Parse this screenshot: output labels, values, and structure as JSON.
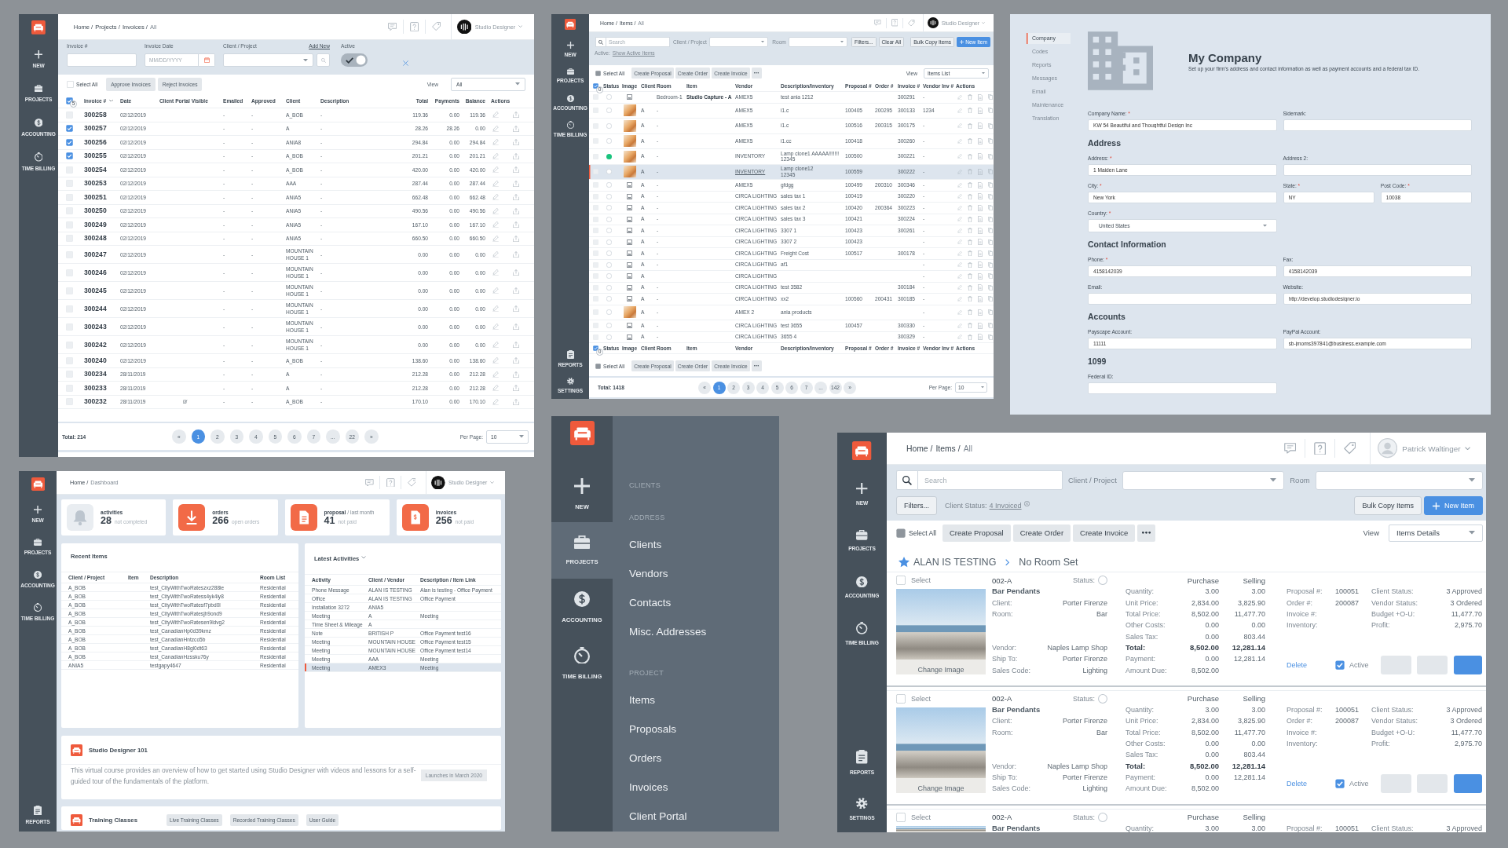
{
  "invoices_page": {
    "sidebar": {
      "items": [
        {
          "kind": "new",
          "label": "NEW"
        },
        {
          "kind": "projects",
          "label": "PROJECTS"
        },
        {
          "kind": "accounting",
          "label": "ACCOUNTING"
        },
        {
          "kind": "timebilling",
          "label": "TIME BILLING"
        }
      ]
    },
    "top_bar": {
      "breadcrumb": [
        "Home /",
        "Projects /",
        "Invoices /",
        "All"
      ],
      "user": {
        "kind": "logo",
        "name": "Studio Designer"
      }
    },
    "filters": {
      "invoice_label": "Invoice #",
      "date_label": "Invoice Date",
      "date_placeholder": "MM/DD/YYYY",
      "client_label": "Client / Project",
      "add_new": "Add New",
      "active_label": "Active",
      "active_on": true
    },
    "toolbar": {
      "select_all": "Select All",
      "select_all_checked": false,
      "buttons": [
        "Approve Invoices",
        "Reject Invoices"
      ],
      "view_label": "View",
      "view_value": "All"
    },
    "table": {
      "header_checked": true,
      "selected_count": "5",
      "columns": [
        "Invoice #",
        "Date",
        "Client Portal Visible",
        "Emailed",
        "Approved",
        "Client",
        "Description",
        "Total",
        "Payments",
        "Balance",
        "Actions"
      ],
      "rows": [
        {
          "checked": false,
          "invoice": "300258",
          "date": "02/12/2019",
          "portal_visible": false,
          "emailed": "-",
          "approved": "-",
          "client": "A_BOB",
          "description": "-",
          "total": "119.36",
          "payments": "0.00",
          "balance": "119.36"
        },
        {
          "checked": true,
          "invoice": "300257",
          "date": "02/12/2019",
          "portal_visible": false,
          "emailed": "-",
          "approved": "-",
          "client": "A",
          "description": "-",
          "total": "28.26",
          "payments": "28.26",
          "balance": "0.00"
        },
        {
          "checked": true,
          "invoice": "300256",
          "date": "02/12/2019",
          "portal_visible": false,
          "emailed": "-",
          "approved": "-",
          "client": "ANIA8",
          "description": "-",
          "total": "294.84",
          "payments": "0.00",
          "balance": "294.84"
        },
        {
          "checked": true,
          "invoice": "300255",
          "date": "02/12/2019",
          "portal_visible": false,
          "emailed": "-",
          "approved": "-",
          "client": "A_BOB",
          "description": "-",
          "total": "201.21",
          "payments": "0.00",
          "balance": "201.21"
        },
        {
          "checked": false,
          "invoice": "300254",
          "date": "02/12/2019",
          "portal_visible": false,
          "emailed": "-",
          "approved": "-",
          "client": "A_BOB",
          "description": "-",
          "total": "420.00",
          "payments": "0.00",
          "balance": "420.00"
        },
        {
          "checked": false,
          "invoice": "300253",
          "date": "02/12/2019",
          "portal_visible": false,
          "emailed": "-",
          "approved": "-",
          "client": "AAA",
          "description": "-",
          "total": "287.44",
          "payments": "0.00",
          "balance": "287.44"
        },
        {
          "checked": false,
          "invoice": "300251",
          "date": "02/12/2019",
          "portal_visible": false,
          "emailed": "-",
          "approved": "-",
          "client": "ANIA5",
          "description": "-",
          "total": "662.48",
          "payments": "0.00",
          "balance": "662.48"
        },
        {
          "checked": false,
          "invoice": "300250",
          "date": "02/12/2019",
          "portal_visible": false,
          "emailed": "-",
          "approved": "-",
          "client": "ANIA5",
          "description": "-",
          "total": "490.56",
          "payments": "0.00",
          "balance": "490.56"
        },
        {
          "checked": false,
          "invoice": "300249",
          "date": "02/12/2019",
          "portal_visible": false,
          "emailed": "-",
          "approved": "-",
          "client": "ANIA5",
          "description": "-",
          "total": "167.10",
          "payments": "0.00",
          "balance": "167.10"
        },
        {
          "checked": false,
          "invoice": "300248",
          "date": "02/12/2019",
          "portal_visible": false,
          "emailed": "-",
          "approved": "-",
          "client": "ANIA5",
          "description": "-",
          "total": "660.50",
          "payments": "0.00",
          "balance": "660.50"
        },
        {
          "checked": false,
          "invoice": "300247",
          "date": "02/12/2019",
          "portal_visible": false,
          "emailed": "-",
          "approved": "-",
          "client": "MOUNTAIN HOUSE 1",
          "description": "-",
          "total": "0.00",
          "payments": "0.00",
          "balance": "0.00"
        },
        {
          "checked": false,
          "invoice": "300246",
          "date": "02/12/2019",
          "portal_visible": false,
          "emailed": "-",
          "approved": "-",
          "client": "MOUNTAIN HOUSE 1",
          "description": "-",
          "total": "0.00",
          "payments": "0.00",
          "balance": "0.00"
        },
        {
          "checked": false,
          "invoice": "300245",
          "date": "02/12/2019",
          "portal_visible": false,
          "emailed": "-",
          "approved": "-",
          "client": "MOUNTAIN HOUSE 1",
          "description": "-",
          "total": "0.00",
          "payments": "0.00",
          "balance": "0.00"
        },
        {
          "checked": false,
          "invoice": "300244",
          "date": "02/12/2019",
          "portal_visible": false,
          "emailed": "-",
          "approved": "-",
          "client": "MOUNTAIN HOUSE 1",
          "description": "-",
          "total": "0.00",
          "payments": "0.00",
          "balance": "0.00"
        },
        {
          "checked": false,
          "invoice": "300243",
          "date": "02/12/2019",
          "portal_visible": false,
          "emailed": "-",
          "approved": "-",
          "client": "MOUNTAIN HOUSE 1",
          "description": "-",
          "total": "0.00",
          "payments": "0.00",
          "balance": "0.00"
        },
        {
          "checked": false,
          "invoice": "300242",
          "date": "02/12/2019",
          "portal_visible": false,
          "emailed": "-",
          "approved": "-",
          "client": "MOUNTAIN HOUSE 1",
          "description": "-",
          "total": "0.00",
          "payments": "0.00",
          "balance": "0.00"
        },
        {
          "checked": false,
          "invoice": "300240",
          "date": "02/12/2019",
          "portal_visible": false,
          "emailed": "-",
          "approved": "-",
          "client": "A_BOB",
          "description": "-",
          "total": "138.60",
          "payments": "0.00",
          "balance": "138.60"
        },
        {
          "checked": false,
          "invoice": "300234",
          "date": "28/11/2019",
          "portal_visible": false,
          "emailed": "-",
          "approved": "-",
          "client": "A",
          "description": "-",
          "total": "212.28",
          "payments": "0.00",
          "balance": "212.28"
        },
        {
          "checked": false,
          "invoice": "300233",
          "date": "28/11/2019",
          "portal_visible": false,
          "emailed": "-",
          "approved": "-",
          "client": "A",
          "description": "-",
          "total": "212.28",
          "payments": "0.00",
          "balance": "212.28"
        },
        {
          "checked": false,
          "invoice": "300232",
          "date": "28/11/2019",
          "portal_visible": true,
          "emailed": "-",
          "approved": "-",
          "client": "A_BOB",
          "description": "-",
          "total": "170.10",
          "payments": "0.00",
          "balance": "170.10"
        }
      ]
    },
    "footer": {
      "total": "Total: 214",
      "pages": [
        {
          "label": "«",
          "selected": false
        },
        {
          "label": "1",
          "selected": true
        },
        {
          "label": "2",
          "selected": false
        },
        {
          "label": "3",
          "selected": false
        },
        {
          "label": "4",
          "selected": false
        },
        {
          "label": "5",
          "selected": false
        },
        {
          "label": "6",
          "selected": false
        },
        {
          "label": "7",
          "selected": false
        },
        {
          "label": "...",
          "selected": false
        },
        {
          "label": "22",
          "selected": false
        },
        {
          "label": "»",
          "selected": false
        }
      ],
      "per_page_label": "Per Page:",
      "per_page": "10"
    }
  },
  "items_list_page": {
    "sidebar": {
      "items": [
        {
          "kind": "new",
          "label": "NEW"
        },
        {
          "kind": "projects",
          "label": "PROJECTS"
        },
        {
          "kind": "accounting",
          "label": "ACCOUNTING"
        },
        {
          "kind": "timebilling",
          "label": "TIME BILLING"
        }
      ],
      "bottom_items": [
        {
          "kind": "reports",
          "label": "REPORTS"
        },
        {
          "kind": "settings",
          "label": "SETTINGS"
        }
      ]
    },
    "top_bar": {
      "breadcrumb": [
        "Home /",
        "Items /",
        "All"
      ],
      "user": {
        "kind": "logo",
        "name": "Studio Designer"
      }
    },
    "filters": {
      "search_placeholder": "Search",
      "client_label": "Client / Project",
      "room_label": "Room",
      "buttons": [
        "Filters...",
        "Clear All"
      ],
      "bulk_copy": "Bulk Copy Items",
      "new_item": "New Item",
      "active_label": "Active:",
      "active_link": "Show Active Items"
    },
    "toolbar": {
      "select_all": "Select All",
      "select_all_checked": false,
      "buttons": [
        "Create Proposal",
        "Create Order",
        "Create Invoice"
      ],
      "view_label": "View",
      "view_value": "Items List"
    },
    "table": {
      "header_checked": true,
      "header_count": "0",
      "columns": [
        "Status",
        "Image",
        "Client",
        "Room",
        "Item",
        "Vendor",
        "Description/Inventory",
        "Proposal #",
        "Order #",
        "Invoice #",
        "Vendor Inv #",
        "Actions"
      ],
      "rows": [
        {
          "checked": false,
          "selected": false,
          "status_set": false,
          "kind": "placeholder",
          "room": "Bedroom-1",
          "item": "Studio Capture - A",
          "vendor": "AMEX5",
          "description": "test ania 1212",
          "invoice": "300291",
          "vendor_inv": "-"
        },
        {
          "checked": false,
          "selected": false,
          "status_set": false,
          "kind": "photo",
          "client": "A",
          "room": "-",
          "vendor": "AMEX5",
          "description": "i1.c",
          "proposal": "100405",
          "order": "200295",
          "invoice": "300133",
          "vendor_inv": "1234"
        },
        {
          "checked": false,
          "selected": false,
          "status_set": false,
          "kind": "photo",
          "client": "A",
          "room": "-",
          "vendor": "AMEX5",
          "description": "i1.c",
          "proposal": "100516",
          "order": "200315",
          "invoice": "300175",
          "vendor_inv": "-"
        },
        {
          "checked": false,
          "selected": false,
          "status_set": false,
          "kind": "photo",
          "client": "A",
          "room": "-",
          "vendor": "AMEX5",
          "description": "i1.cc",
          "proposal": "100418",
          "invoice": "300260",
          "vendor_inv": "-"
        },
        {
          "checked": false,
          "selected": false,
          "status_set": true,
          "kind": "photo",
          "client": "A",
          "room": "-",
          "vendor": "INVENTORY",
          "description": "Lamp clone1 AAAAA!!!!!!!\n12345",
          "proposal": "100500",
          "invoice": "300221",
          "vendor_inv": "-"
        },
        {
          "checked": false,
          "selected": true,
          "status_set": false,
          "kind": "photo",
          "client": "A",
          "room": "-",
          "vendor": "INVENTORY",
          "description": "Lamp clone12\n12345",
          "proposal": "100559",
          "invoice": "300222",
          "vendor_inv": "-"
        },
        {
          "checked": false,
          "selected": false,
          "status_set": false,
          "kind": "placeholder",
          "client": "A",
          "room": "-",
          "vendor": "AMEX5",
          "description": "gfdgg",
          "proposal": "100499",
          "order": "200310",
          "invoice": "300346",
          "vendor_inv": "-"
        },
        {
          "checked": false,
          "selected": false,
          "status_set": false,
          "kind": "placeholder",
          "client": "A",
          "room": "-",
          "vendor": "CIRCA LIGHTING",
          "description": "sales tax 1",
          "proposal": "100419",
          "invoice": "300220",
          "vendor_inv": "-"
        },
        {
          "checked": false,
          "selected": false,
          "status_set": false,
          "kind": "placeholder",
          "client": "A",
          "room": "-",
          "vendor": "CIRCA LIGHTING",
          "description": "sales tax 2",
          "proposal": "100420",
          "order": "200364",
          "invoice": "300223",
          "vendor_inv": "-"
        },
        {
          "checked": false,
          "selected": false,
          "status_set": false,
          "kind": "placeholder",
          "client": "A",
          "room": "-",
          "vendor": "CIRCA LIGHTING",
          "description": "sales tax 3",
          "proposal": "100421",
          "invoice": "300224",
          "vendor_inv": "-"
        },
        {
          "checked": false,
          "selected": false,
          "status_set": false,
          "kind": "placeholder",
          "client": "A",
          "room": "-",
          "vendor": "CIRCA LIGHTING",
          "description": "3307 1",
          "proposal": "100423",
          "invoice": "300261",
          "vendor_inv": "-"
        },
        {
          "checked": false,
          "selected": false,
          "status_set": false,
          "kind": "placeholder",
          "client": "A",
          "room": "-",
          "vendor": "CIRCA LIGHTING",
          "description": "3307 2",
          "proposal": "100423",
          "vendor_inv": "-"
        },
        {
          "checked": false,
          "selected": false,
          "status_set": false,
          "kind": "placeholder",
          "client": "A",
          "room": "-",
          "vendor": "CIRCA LIGHTING",
          "description": "Freight Cost",
          "proposal": "100517",
          "invoice": "300178",
          "vendor_inv": "-"
        },
        {
          "checked": false,
          "selected": false,
          "status_set": false,
          "kind": "placeholder",
          "client": "A",
          "room": "-",
          "vendor": "CIRCA LIGHTING",
          "description": "af1",
          "vendor_inv": "-"
        },
        {
          "checked": false,
          "selected": false,
          "status_set": false,
          "kind": "placeholder",
          "client": "A",
          "vendor": "CIRCA LIGHTING",
          "vendor_inv": "-"
        },
        {
          "checked": false,
          "selected": false,
          "status_set": false,
          "kind": "placeholder",
          "client": "A",
          "room": "-",
          "vendor": "CIRCA LIGHTING",
          "description": "test 3582",
          "invoice": "300184",
          "vendor_inv": "-"
        },
        {
          "checked": false,
          "selected": false,
          "status_set": false,
          "kind": "placeholder",
          "client": "A",
          "room": "-",
          "vendor": "CIRCA LIGHTING",
          "description": "xx2",
          "proposal": "100560",
          "order": "200431",
          "invoice": "300185",
          "vendor_inv": "-"
        },
        {
          "checked": false,
          "selected": false,
          "status_set": false,
          "kind": "photo",
          "client": "A",
          "room": "-",
          "vendor": "AMEX 2",
          "description": "ania products",
          "vendor_inv": "-"
        },
        {
          "checked": false,
          "selected": false,
          "status_set": false,
          "kind": "placeholder",
          "client": "A",
          "room": "-",
          "vendor": "CIRCA LIGHTING",
          "description": "test 3655",
          "proposal": "100457",
          "invoice": "300330",
          "vendor_inv": "-"
        },
        {
          "checked": false,
          "selected": false,
          "status_set": false,
          "kind": "placeholder",
          "client": "A",
          "room": "-",
          "vendor": "CIRCA LIGHTING",
          "description": "3655 4",
          "invoice": "300329",
          "vendor_inv": "-"
        }
      ]
    },
    "footer_header": {
      "checked": true,
      "count": "0",
      "columns": [
        "Status",
        "Image",
        "Client",
        "Room",
        "Item",
        "Vendor",
        "Description/Inventory",
        "Proposal #",
        "Order #",
        "Invoice #",
        "Vendor Inv #",
        "Actions"
      ]
    },
    "bottom_toolbar": {
      "select_all": "Select All",
      "select_all_checked": false,
      "buttons": [
        "Create Proposal",
        "Create Order",
        "Create Invoice"
      ]
    },
    "footer": {
      "total": "Total: 1418",
      "pages": [
        {
          "label": "«",
          "selected": false
        },
        {
          "label": "1",
          "selected": true
        },
        {
          "label": "2",
          "selected": false
        },
        {
          "label": "3",
          "selected": false
        },
        {
          "label": "4",
          "selected": false
        },
        {
          "label": "5",
          "selected": false
        },
        {
          "label": "6",
          "selected": false
        },
        {
          "label": "7",
          "selected": false
        },
        {
          "label": "...",
          "selected": false
        },
        {
          "label": "142",
          "selected": false
        },
        {
          "label": "»",
          "selected": false
        }
      ],
      "per_page_label": "Per Page:",
      "per_page": "10"
    }
  },
  "company_page": {
    "nav": [
      {
        "label": "Company",
        "selected": true
      },
      {
        "label": "Codes",
        "selected": false
      },
      {
        "label": "Reports",
        "selected": false
      },
      {
        "label": "Messages",
        "selected": false
      },
      {
        "label": "Email",
        "selected": false
      },
      {
        "label": "Maintenance",
        "selected": false
      },
      {
        "label": "Translation",
        "selected": false
      }
    ],
    "title": "My Company",
    "subtitle": "Set up your firm's address and contact information as well as payment accounts and a federal tax ID.",
    "sections": [
      {
        "fields": [
          {
            "kind": "text",
            "label": "Company Name:",
            "mark": "*",
            "value": "KW 54 Beautiful and Thoughtful Design Inc"
          },
          {
            "kind": "text",
            "label": "Sidemark:"
          }
        ]
      },
      {
        "heading": "Address",
        "fields": [
          {
            "kind": "text",
            "label": "Address:",
            "mark": "*",
            "value": "1 Maiden Lane"
          },
          {
            "kind": "text",
            "label": "Address 2:"
          },
          {
            "kind": "text",
            "label": "City:",
            "mark": "*",
            "value": "New York"
          },
          {
            "kind": "half",
            "label": "State:",
            "mark": "*",
            "value": "NY"
          },
          {
            "kind": "half",
            "label": "Post Code:",
            "mark": "*",
            "value": "10038"
          },
          {
            "kind": "select",
            "label": "Country:",
            "mark": "*",
            "value": "United States"
          }
        ]
      },
      {
        "heading": "Contact Information",
        "fields": [
          {
            "kind": "text",
            "label": "Phone:",
            "mark": "*",
            "value": "4158142039"
          },
          {
            "kind": "text",
            "label": "Fax:",
            "value": "4158142039"
          },
          {
            "kind": "text",
            "label": "Email:"
          },
          {
            "kind": "text",
            "label": "Website:",
            "value": "http://develop.studiodesigner.io"
          }
        ]
      },
      {
        "heading": "Accounts",
        "fields": [
          {
            "kind": "text",
            "label": "Payscape Account:",
            "value": "11111"
          },
          {
            "kind": "text",
            "label": "PayPal Account:",
            "value": "sb-jmoms397841@business.example.com"
          }
        ]
      },
      {
        "heading": "1099",
        "fields": [
          {
            "kind": "text",
            "label": "Federal ID:"
          }
        ]
      }
    ]
  },
  "dashboard_page": {
    "sidebar": {
      "items": [
        {
          "kind": "new",
          "label": "NEW"
        },
        {
          "kind": "projects",
          "label": "PROJECTS"
        },
        {
          "kind": "accounting",
          "label": "ACCOUNTING"
        },
        {
          "kind": "timebilling",
          "label": "TIME BILLING"
        }
      ],
      "bottom_items": [
        {
          "kind": "reports",
          "label": "REPORTS"
        }
      ]
    },
    "top_bar": {
      "breadcrumb": [
        "Home /",
        "Dashboard"
      ],
      "user": {
        "kind": "logo",
        "name": "Studio Designer"
      }
    },
    "stats": [
      {
        "kind": "bell",
        "label": "activities",
        "value": "28",
        "note": "not completed"
      },
      {
        "kind": "download",
        "label": "orders",
        "value": "266",
        "note": "open orders"
      },
      {
        "kind": "proposal",
        "label": "proposal",
        "qualifier": "/ last month",
        "value": "41",
        "note": "not paid"
      },
      {
        "kind": "invoice",
        "label": "invoices",
        "value": "256",
        "note": "not paid"
      }
    ],
    "recent_items": {
      "title": "Recent Items",
      "columns": [
        "Client / Project",
        "Item",
        "Description",
        "Room List"
      ],
      "rows": [
        {
          "client": "A_BOB",
          "description": "test_CityWithTwoRateszxz288ie",
          "room_list": "Residential"
        },
        {
          "client": "A_BOB",
          "description": "test_CityWithTwoRatess4yk4iy8",
          "room_list": "Residential"
        },
        {
          "client": "A_BOB",
          "description": "test_CityWithTwoRatesf7pbd0l",
          "room_list": "Residential"
        },
        {
          "client": "A_BOB",
          "description": "test_CityWithTwoRatesjh9ond9",
          "room_list": "Residential"
        },
        {
          "client": "A_BOB",
          "description": "test_CityWithTwoRatesen9ldvg2",
          "room_list": "Residential"
        },
        {
          "client": "A_BOB",
          "description": "test_CanadianHp0d39kmz",
          "room_list": "Residential"
        },
        {
          "client": "A_BOB",
          "description": "test_CanadianHntzco5b",
          "room_list": "Residential"
        },
        {
          "client": "A_BOB",
          "description": "test_CanadianH8gl0dt63",
          "room_list": "Residential"
        },
        {
          "client": "A_BOB",
          "description": "test_CanadianHzssku76y",
          "room_list": "Residential"
        },
        {
          "client": "ANIA5",
          "description": "testgapy4647",
          "room_list": "Residential"
        }
      ]
    },
    "latest_activities": {
      "title": "Latest Activities",
      "columns": [
        "Activity",
        "Client / Vendor",
        "Description / Item Link"
      ],
      "rows": [
        {
          "selected": false,
          "activity": "Phone Message",
          "client": "ALAN IS TESTING",
          "description": "Alan is testing - Office Payment"
        },
        {
          "selected": false,
          "activity": "Office",
          "client": "ALAN IS TESTING",
          "description": "Office Payment"
        },
        {
          "selected": false,
          "activity": "Installation 3272",
          "client": "ANIA5"
        },
        {
          "selected": false,
          "activity": "Meeting",
          "client": "A",
          "description": "Meeting"
        },
        {
          "selected": false,
          "activity": "Time Sheet & Mileage",
          "client": "A"
        },
        {
          "selected": false,
          "activity": "Note",
          "client": "BRITISH P",
          "description": "Office Payment test16"
        },
        {
          "selected": false,
          "activity": "Meeting",
          "client": "MOUNTAIN HOUSE",
          "description": "Office Payment test15"
        },
        {
          "selected": false,
          "activity": "Meeting",
          "client": "MOUNTAIN HOUSE",
          "description": "Office Payment test14"
        },
        {
          "selected": false,
          "activity": "Meeting",
          "client": "AAA",
          "description": "Meeting"
        },
        {
          "selected": true,
          "activity": "Meeting",
          "client": "AMEX3",
          "description": "Meeting"
        }
      ]
    },
    "course": {
      "title": "Studio Designer 101",
      "text": "This virtual course provides an overview of how to get started using Studio Designer with videos and lessons for a self-guided tour of the fundamentals of the platform.",
      "badge": "Launches in March 2020"
    },
    "training": {
      "title": "Training Classes",
      "buttons": [
        "Live Training Classes",
        "Recorded Training Classes",
        "User Guide"
      ]
    }
  },
  "menu_page": {
    "sidebar": {
      "items": [
        {
          "kind": "new",
          "label": "NEW",
          "selected": false
        },
        {
          "kind": "projects",
          "label": "PROJECTS",
          "selected": true
        },
        {
          "kind": "accounting",
          "label": "ACCOUNTING",
          "selected": false
        },
        {
          "kind": "timebilling",
          "label": "TIME BILLING",
          "selected": false
        }
      ]
    },
    "sections": [
      {
        "heading": "CLIENTS"
      },
      {
        "heading": "ADDRESS",
        "items": [
          "Clients",
          "Vendors",
          "Contacts",
          "Misc. Addresses"
        ]
      },
      {
        "heading": "PROJECT",
        "items": [
          "Items",
          "Proposals",
          "Orders",
          "Invoices",
          "Client Portal"
        ]
      }
    ]
  },
  "item_details_page": {
    "sidebar": {
      "items": [
        {
          "kind": "new",
          "label": "NEW"
        },
        {
          "kind": "projects",
          "label": "PROJECTS"
        },
        {
          "kind": "accounting",
          "label": "ACCOUNTING"
        },
        {
          "kind": "timebilling",
          "label": "TIME BILLING"
        }
      ],
      "bottom_items": [
        {
          "kind": "reports",
          "label": "REPORTS"
        },
        {
          "kind": "settings",
          "label": "SETTINGS"
        }
      ]
    },
    "top_bar": {
      "breadcrumb": [
        "Home /",
        "Items /",
        "All"
      ],
      "user": {
        "kind": "person",
        "name": "Patrick Waltinger"
      }
    },
    "filters": {
      "search_placeholder": "Search",
      "client_label": "Client / Project",
      "room_label": "Room",
      "filters_button": "Filters...",
      "client_status_label": "Client Status:",
      "client_status_value": "4 Invoiced",
      "bulk_copy": "Bulk Copy Items",
      "new_item": "New Item"
    },
    "toolbar": {
      "select_all": "Select All",
      "select_all_checked": false,
      "buttons": [
        "Create Proposal",
        "Create Order",
        "Create Invoice"
      ],
      "view_label": "View",
      "view_value": "Items Details"
    },
    "group": {
      "client": "ALAN IS TESTING",
      "room": "No Room Set"
    },
    "cards": [
      {
        "checked": false,
        "select_label": "Select",
        "code": "002-A",
        "status_label": "Status:",
        "status_set": false,
        "photo_caption": "Change Image",
        "name": "Bar Pendants",
        "details_top": [
          {
            "label": "Client:",
            "value": "Porter Firenze"
          },
          {
            "label": "Room:",
            "value": "Bar"
          }
        ],
        "details_bottom": [
          {
            "label": "Vendor:",
            "value": "Naples Lamp Shop"
          },
          {
            "label": "Ship To:",
            "value": "Porter Firenze"
          },
          {
            "label": "Sales Code:",
            "value": "Lighting"
          }
        ],
        "price_headers": [
          "Purchase",
          "Selling"
        ],
        "pricing": [
          {
            "kind": "line",
            "label": "Quantity:",
            "purchase": "3.00",
            "selling": "3.00"
          },
          {
            "kind": "line",
            "label": "Unit Price:",
            "purchase": "2,834.00",
            "selling": "3,825.90"
          },
          {
            "kind": "line",
            "label": "Total Price:",
            "purchase": "8,502.00",
            "selling": "11,477.70"
          },
          {
            "kind": "line",
            "label": "Other Costs:",
            "purchase": "0.00",
            "selling": "0.00"
          },
          {
            "kind": "line",
            "label": "Sales Tax:",
            "purchase": "0.00",
            "selling": "803.44"
          },
          {
            "kind": "total",
            "label": "Total:",
            "purchase": "8,502.00",
            "selling": "12,281.14"
          },
          {
            "kind": "line",
            "label": "Payment:",
            "purchase": "0.00",
            "selling": "12,281.14"
          },
          {
            "kind": "line",
            "label": "Amount Due:",
            "purchase": "8,502.00"
          }
        ],
        "info_left": [
          {
            "label": "Proposal #:",
            "value": "100051"
          },
          {
            "label": "Order #:",
            "value": "200087"
          },
          {
            "label": "Invoice #:"
          },
          {
            "label": "Inventory:"
          }
        ],
        "info_right": [
          {
            "label": "Client Status:",
            "value": "3 Approved"
          },
          {
            "label": "Vendor Status:",
            "value": "3 Ordered"
          },
          {
            "label": "Budget +O-U:",
            "value": "11,477.70"
          },
          {
            "label": "Profit:",
            "value": "2,975.70"
          }
        ],
        "delete_label": "Delete",
        "active_label": "Active",
        "active": true,
        "buttons": [
          {
            "kind": "secondary"
          },
          {
            "kind": "secondary"
          },
          {
            "kind": "primary"
          }
        ]
      },
      {
        "checked": false,
        "select_label": "Select",
        "code": "002-A",
        "status_label": "Status:",
        "status_set": false,
        "photo_caption": "Change Image",
        "name": "Bar Pendants",
        "details_top": [
          {
            "label": "Client:",
            "value": "Porter Firenze"
          },
          {
            "label": "Room:",
            "value": "Bar"
          }
        ],
        "details_bottom": [
          {
            "label": "Vendor:",
            "value": "Naples Lamp Shop"
          },
          {
            "label": "Ship To:",
            "value": "Porter Firenze"
          },
          {
            "label": "Sales Code:",
            "value": "Lighting"
          }
        ],
        "price_headers": [
          "Purchase",
          "Selling"
        ],
        "pricing": [
          {
            "kind": "line",
            "label": "Quantity:",
            "purchase": "3.00",
            "selling": "3.00"
          },
          {
            "kind": "line",
            "label": "Unit Price:",
            "purchase": "2,834.00",
            "selling": "3,825.90"
          },
          {
            "kind": "line",
            "label": "Total Price:",
            "purchase": "8,502.00",
            "selling": "11,477.70"
          },
          {
            "kind": "line",
            "label": "Other Costs:",
            "purchase": "0.00",
            "selling": "0.00"
          },
          {
            "kind": "line",
            "label": "Sales Tax:",
            "purchase": "0.00",
            "selling": "803.44"
          },
          {
            "kind": "total",
            "label": "Total:",
            "purchase": "8,502.00",
            "selling": "12,281.14"
          },
          {
            "kind": "line",
            "label": "Payment:",
            "purchase": "0.00",
            "selling": "12,281.14"
          },
          {
            "kind": "line",
            "label": "Amount Due:",
            "purchase": "8,502.00"
          }
        ],
        "info_left": [
          {
            "label": "Proposal #:",
            "value": "100051"
          },
          {
            "label": "Order #:",
            "value": "200087"
          },
          {
            "label": "Invoice #:"
          },
          {
            "label": "Inventory:"
          }
        ],
        "info_right": [
          {
            "label": "Client Status:",
            "value": "3 Approved"
          },
          {
            "label": "Vendor Status:",
            "value": "3 Ordered"
          },
          {
            "label": "Budget +O-U:",
            "value": "11,477.70"
          },
          {
            "label": "Profit:",
            "value": "2,975.70"
          }
        ],
        "delete_label": "Delete",
        "active_label": "Active",
        "active": true,
        "buttons": [
          {
            "kind": "secondary"
          },
          {
            "kind": "secondary"
          },
          {
            "kind": "primary"
          }
        ]
      },
      {
        "checked": false,
        "select_label": "Select",
        "code": "002-A",
        "status_label": "Status:",
        "status_set": false,
        "name": "Bar Pendants",
        "price_headers": [
          "Purchase",
          "Selling"
        ],
        "pricing": [
          {
            "kind": "line",
            "label": "Quantity:",
            "purchase": "3.00",
            "selling": "3.00"
          }
        ],
        "info_left": [
          {
            "label": "Proposal #:",
            "value": "100051"
          }
        ],
        "info_right": [
          {
            "label": "Client Status:",
            "value": "3 Approved"
          }
        ]
      }
    ]
  }
}
